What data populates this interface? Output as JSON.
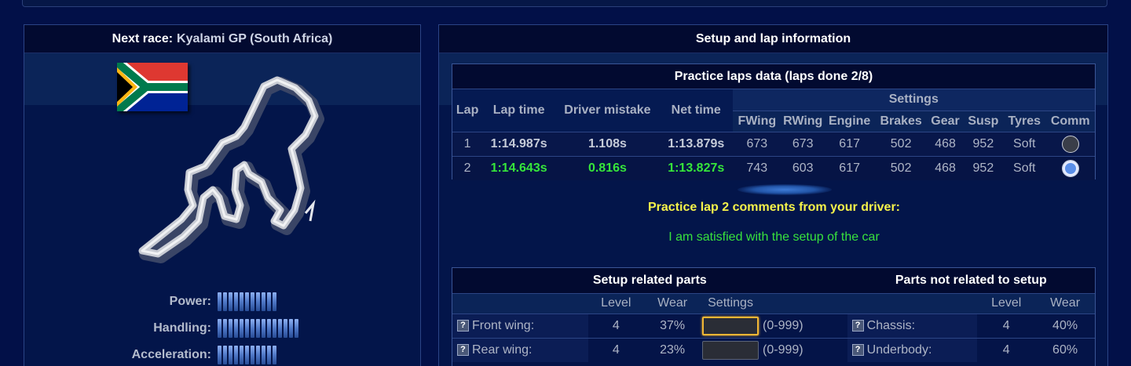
{
  "next_race": {
    "label": "Next race:",
    "name": "Kyalami GP (South Africa)"
  },
  "flag": {
    "country": "South Africa",
    "icon": "south-africa-flag-icon"
  },
  "track_map": {
    "icon": "track-map-icon"
  },
  "car_stats": [
    {
      "label": "Power:",
      "bars": 11
    },
    {
      "label": "Handling:",
      "bars": 15
    },
    {
      "label": "Acceleration:",
      "bars": 11
    }
  ],
  "setup_panel": {
    "title": "Setup and lap information",
    "practice": {
      "title": "Practice laps data (laps done 2/8)",
      "headers": {
        "lap": "Lap",
        "lap_time": "Lap time",
        "driver_mistake": "Driver mistake",
        "net_time": "Net time",
        "settings": "Settings",
        "fwing": "FWing",
        "rwing": "RWing",
        "engine": "Engine",
        "brakes": "Brakes",
        "gear": "Gear",
        "susp": "Susp",
        "tyres": "Tyres",
        "comm": "Comm"
      },
      "laps": [
        {
          "lap": "1",
          "lap_time": "1:14.987s",
          "mistake": "1.108s",
          "net_time": "1:13.879s",
          "fwing": "673",
          "rwing": "673",
          "engine": "617",
          "brakes": "502",
          "gear": "468",
          "susp": "952",
          "tyres": "Soft"
        },
        {
          "lap": "2",
          "lap_time": "1:14.643s",
          "mistake": "0.816s",
          "net_time": "1:13.827s",
          "fwing": "743",
          "rwing": "603",
          "engine": "617",
          "brakes": "502",
          "gear": "468",
          "susp": "952",
          "tyres": "Soft"
        }
      ]
    },
    "comments": {
      "title": "Practice lap 2 comments from your driver:",
      "text": "I am satisfied with the setup of the car"
    },
    "parts": {
      "setup_title": "Setup related parts",
      "other_title": "Parts not related to setup",
      "headers": {
        "level": "Level",
        "wear": "Wear",
        "settings": "Settings"
      },
      "setup_rows": [
        {
          "name": "Front wing:",
          "level": "4",
          "wear": "37%",
          "value": "",
          "range": "(0-999)"
        },
        {
          "name": "Rear wing:",
          "level": "4",
          "wear": "23%",
          "value": "",
          "range": "(0-999)"
        }
      ],
      "other_rows": [
        {
          "name": "Chassis:",
          "level": "4",
          "wear": "40%"
        },
        {
          "name": "Underbody:",
          "level": "4",
          "wear": "60%"
        }
      ]
    }
  },
  "colors": {
    "background": "#021048",
    "panel_header": "#020a30",
    "best_lap_green": "#36e63a",
    "comment_yellow": "#f5f24a",
    "focus_orange": "#f2b634"
  }
}
